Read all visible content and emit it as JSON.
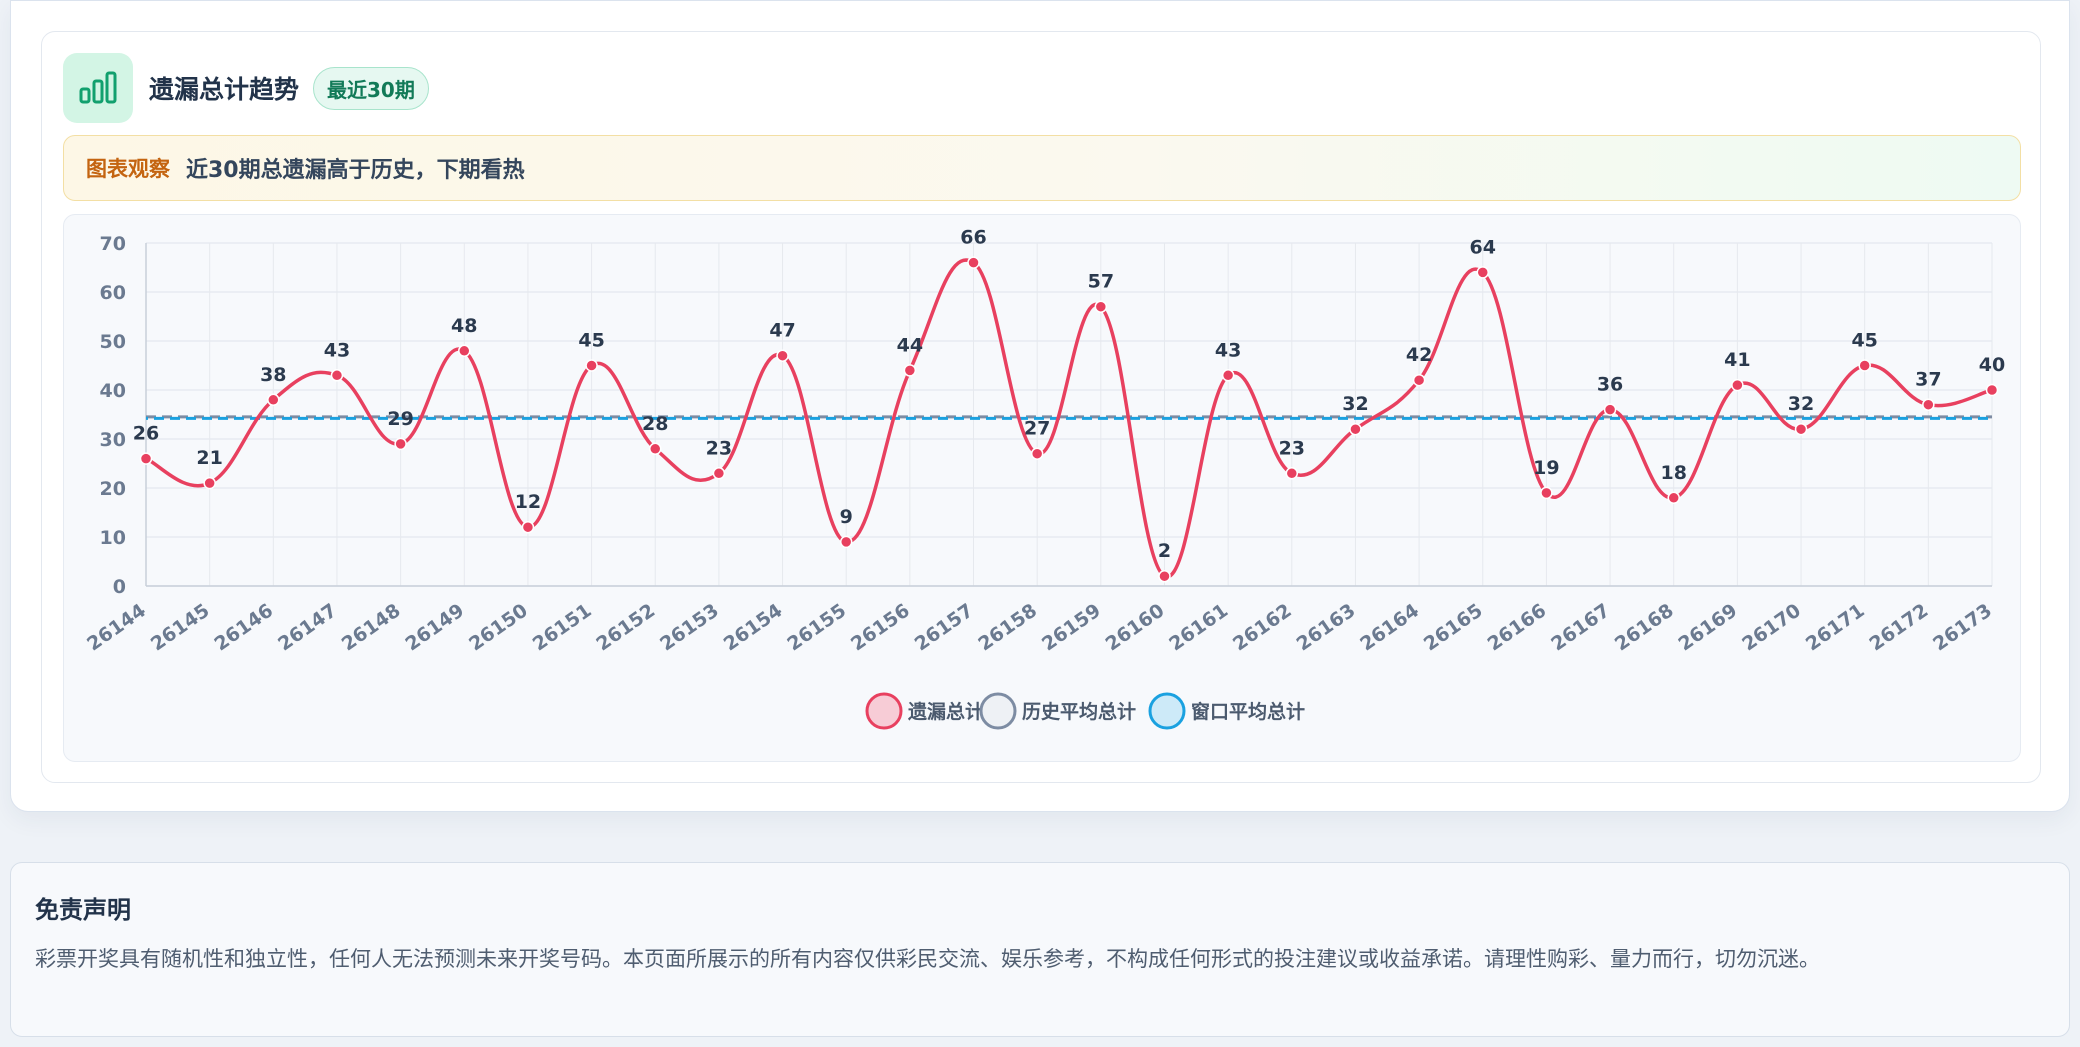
{
  "header": {
    "title": "遗漏总计趋势",
    "badge": "最近30期",
    "icon": "bar-chart-icon"
  },
  "insight": {
    "label": "图表观察",
    "text": "近30期总遗漏高于历史，下期看热"
  },
  "colors": {
    "accent_green": "#12a06e",
    "series_total": "#e8405f",
    "series_history": "#7d8ca3",
    "series_window": "#1aa1e0"
  },
  "chart_data": {
    "type": "line",
    "categories": [
      "26144",
      "26145",
      "26146",
      "26147",
      "26148",
      "26149",
      "26150",
      "26151",
      "26152",
      "26153",
      "26154",
      "26155",
      "26156",
      "26157",
      "26158",
      "26159",
      "26160",
      "26161",
      "26162",
      "26163",
      "26164",
      "26165",
      "26166",
      "26167",
      "26168",
      "26169",
      "26170",
      "26171",
      "26172",
      "26173"
    ],
    "series": [
      {
        "name": "遗漏总计",
        "values": [
          26,
          21,
          38,
          43,
          29,
          48,
          12,
          45,
          28,
          23,
          47,
          9,
          44,
          66,
          27,
          57,
          2,
          43,
          23,
          32,
          42,
          64,
          19,
          36,
          18,
          41,
          32,
          45,
          37,
          40
        ]
      },
      {
        "name": "历史平均总计",
        "values": [
          34.5,
          34.5,
          34.5,
          34.5,
          34.5,
          34.5,
          34.5,
          34.5,
          34.5,
          34.5,
          34.5,
          34.5,
          34.5,
          34.5,
          34.5,
          34.5,
          34.5,
          34.5,
          34.5,
          34.5,
          34.5,
          34.5,
          34.5,
          34.5,
          34.5,
          34.5,
          34.5,
          34.5,
          34.5,
          34.5
        ]
      },
      {
        "name": "窗口平均总计",
        "values": [
          34.2,
          34.2,
          34.2,
          34.2,
          34.2,
          34.2,
          34.2,
          34.2,
          34.2,
          34.2,
          34.2,
          34.2,
          34.2,
          34.2,
          34.2,
          34.2,
          34.2,
          34.2,
          34.2,
          34.2,
          34.2,
          34.2,
          34.2,
          34.2,
          34.2,
          34.2,
          34.2,
          34.2,
          34.2,
          34.2
        ]
      }
    ],
    "ylim": [
      0,
      70
    ],
    "yticks": [
      0,
      10,
      20,
      30,
      40,
      50,
      60,
      70
    ],
    "grid": true,
    "legend": "bottom-center"
  },
  "disclaimer": {
    "title": "免责声明",
    "text": "彩票开奖具有随机性和独立性，任何人无法预测未来开奖号码。本页面所展示的所有内容仅供彩民交流、娱乐参考，不构成任何形式的投注建议或收益承诺。请理性购彩、量力而行，切勿沉迷。"
  }
}
